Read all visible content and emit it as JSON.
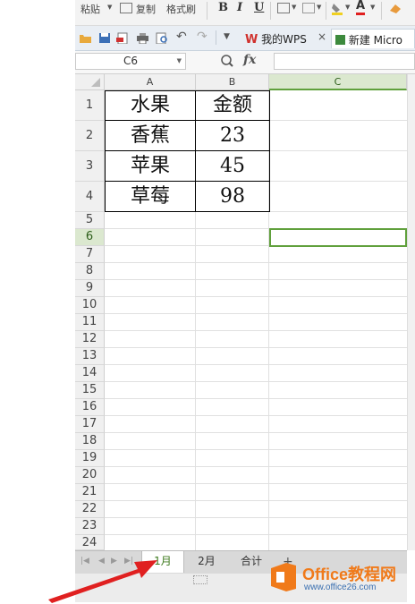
{
  "ribbon": {
    "paste_label": "粘贴",
    "copy_label": "复制",
    "format_painter_label": "格式刷",
    "bold": "B",
    "italic": "I",
    "underline": "U"
  },
  "quickbar": {
    "tabs": [
      {
        "label": "我的WPS",
        "close": "×"
      },
      {
        "label": "新建 Micro"
      }
    ]
  },
  "formula_bar": {
    "name_box": "C6",
    "fx_label": "fx",
    "formula": ""
  },
  "columns": [
    "A",
    "B",
    "C"
  ],
  "rows": [
    "1",
    "2",
    "3",
    "4",
    "5",
    "6",
    "7",
    "8",
    "9",
    "10",
    "11",
    "12",
    "13",
    "14",
    "15",
    "16",
    "17",
    "18",
    "19",
    "20",
    "21",
    "22",
    "23",
    "24"
  ],
  "table": {
    "header": [
      "水果",
      "金额"
    ],
    "data": [
      [
        "香蕉",
        "23"
      ],
      [
        "苹果",
        "45"
      ],
      [
        "草莓",
        "98"
      ]
    ]
  },
  "sheet_tabs": [
    "1月",
    "2月",
    "合计"
  ],
  "active_sheet": "1月",
  "selected_cell": "C6",
  "colors": {
    "accent": "#60a03c",
    "selected_header_bg": "#dbe8cf",
    "arrow": "#e02020",
    "logo_orange": "#f07a1a"
  },
  "watermark": {
    "brand": "Office教程网",
    "url": "www.office26.com"
  }
}
